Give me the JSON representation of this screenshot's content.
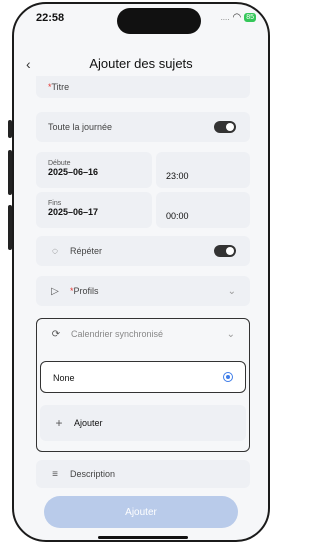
{
  "status_bar": {
    "time": "22:58",
    "wifi_icon": "wifi-icon",
    "battery": "85"
  },
  "header": {
    "title": "Ajouter des sujets",
    "back_icon": "chevron-left-icon"
  },
  "form": {
    "title_field": {
      "required_mark": "*",
      "label": "Titre"
    },
    "all_day": {
      "label": "Toute la journée",
      "toggle_on": true
    },
    "start": {
      "label": "Débute",
      "date": "2025–06–16",
      "time": "23:00"
    },
    "end": {
      "label": "Fins",
      "date": "2025–06–17",
      "time": "00:00"
    },
    "repeat": {
      "label": "Répéter",
      "toggle_on": true,
      "icon": "repeat-icon"
    },
    "profiles": {
      "required_mark": "*",
      "label": "Profils",
      "icon": "tag-icon"
    },
    "sync_calendar": {
      "label": "Calendrier synchronisé",
      "icon": "sync-icon"
    },
    "sync_option": {
      "label": "None",
      "selected": true
    },
    "add_button": {
      "icon": "plus-icon",
      "label": "Ajouter"
    },
    "description": {
      "label": "Description",
      "icon": "list-icon"
    }
  },
  "footer": {
    "submit_label": "Ajouter"
  }
}
